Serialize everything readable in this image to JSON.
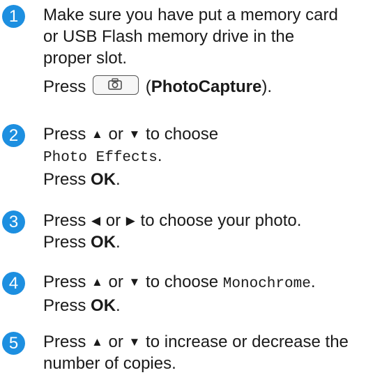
{
  "steps": [
    {
      "number": "1",
      "text_line1": "Make sure you have put a memory card",
      "text_line2": "or USB Flash memory drive in the",
      "text_line3": "proper slot.",
      "press_word": "Press",
      "button_icon": "camera-icon",
      "paren_open": "(",
      "button_name": "PhotoCapture",
      "paren_close": ")."
    },
    {
      "number": "2",
      "press_word": "Press",
      "arrow_up": "▲",
      "or_word": "or",
      "arrow_down": "▼",
      "to_choose": "to choose",
      "menu_option": "Photo Effects",
      "menu_option_end": ".",
      "press_ok_word": "Press",
      "ok_key": "OK",
      "end": "."
    },
    {
      "number": "3",
      "press_word": "Press",
      "arrow_left": "◀",
      "or_word": "or",
      "arrow_right": "▶",
      "to_choose": "to choose your photo.",
      "press_ok_word": "Press",
      "ok_key": "OK",
      "end": "."
    },
    {
      "number": "4",
      "press_word": "Press",
      "arrow_up": "▲",
      "or_word": "or",
      "arrow_down": "▼",
      "to_choose": "to choose",
      "menu_option": "Monochrome",
      "menu_option_end": ".",
      "press_ok_word": "Press",
      "ok_key": "OK",
      "end": "."
    },
    {
      "number": "5",
      "press_word": "Press",
      "arrow_up": "▲",
      "or_word": "or",
      "arrow_down": "▼",
      "text_line1_rest": "to increase or decrease the",
      "text_line2": "number of copies."
    }
  ],
  "colors": {
    "step_badge": "#1d8fe0"
  }
}
